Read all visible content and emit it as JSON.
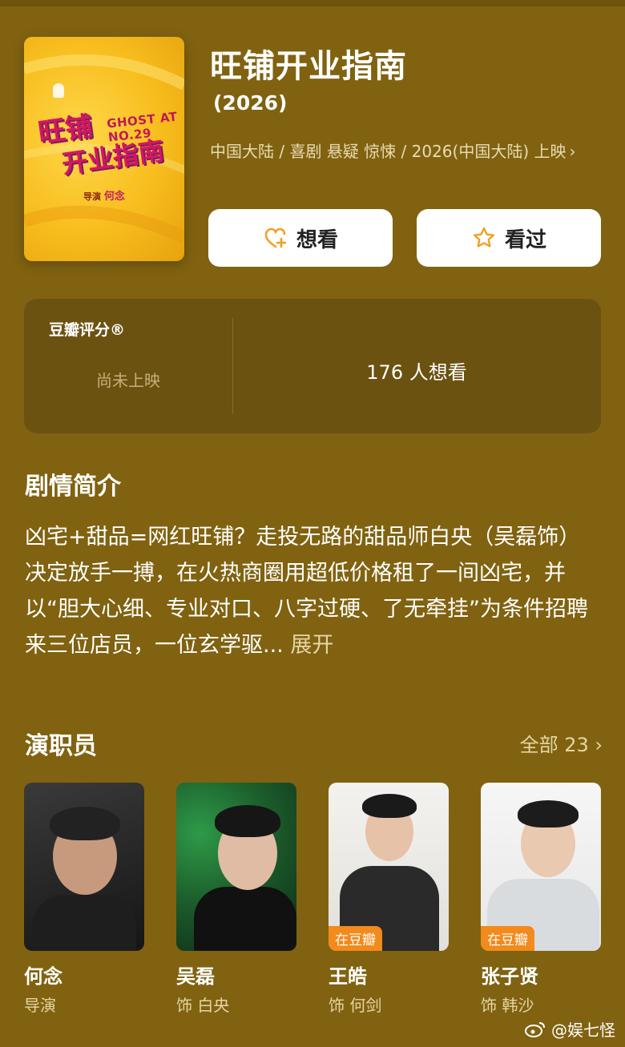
{
  "movie": {
    "title": "旺铺开业指南",
    "year": "(2026)",
    "meta_line": "中国大陆 / 喜剧 悬疑 惊悚 / 2026(中国大陆) 上映",
    "poster": {
      "title_cn_1": "旺铺",
      "title_cn_2": "开业指南",
      "title_en_1": "GHOST AT",
      "title_en_2": "NO.29",
      "credit_label": "导演",
      "credit_name": "何念"
    }
  },
  "actions": {
    "want_label": "想看",
    "seen_label": "看过"
  },
  "rating": {
    "label": "豆瓣评分®",
    "status": "尚未上映",
    "want_count": "176 人想看"
  },
  "synopsis": {
    "heading": "剧情简介",
    "text": "凶宅+甜品=网红旺铺？走投无路的甜品师白央（吴磊饰）决定放手一搏，在火热商圈用超低价格租了一间凶宅，并以“胆大心细、专业对口、八字过硬、了无牵挂”为条件招聘来三位店员，一位玄学驱...",
    "more_label": "展开"
  },
  "cast": {
    "heading": "演职员",
    "all_label": "全部 23",
    "members": [
      {
        "name": "何念",
        "role": "导演",
        "tag": ""
      },
      {
        "name": "吴磊",
        "role": "饰 白央",
        "tag": ""
      },
      {
        "name": "王皓",
        "role": "饰 何剑",
        "tag": "在豆瓣"
      },
      {
        "name": "张子贤",
        "role": "饰 韩沙",
        "tag": "在豆瓣"
      }
    ]
  },
  "watermark": "@娱七怪",
  "colors": {
    "background": "#806210",
    "card": "#6b5211",
    "accent_orange": "#f28a1c",
    "icon_orange": "#f2a024"
  }
}
